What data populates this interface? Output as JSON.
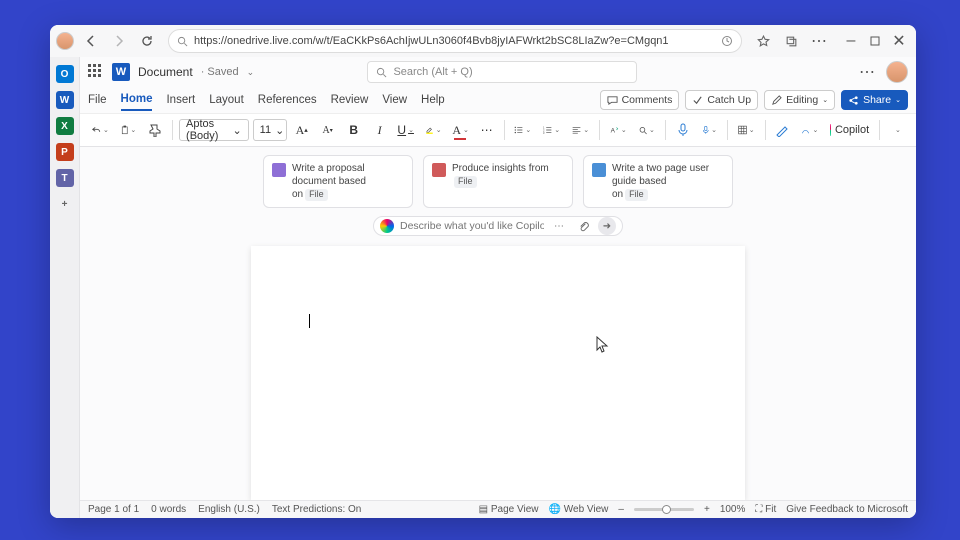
{
  "browser": {
    "url": "https://onedrive.live.com/w/t/EaCKkPs6AchIjwULn3060f4Bvb8jyIAFWrkt2bSC8LIaZw?e=CMgqn1",
    "buttons": {
      "back": "←",
      "forward": "→",
      "refresh": "↻",
      "fav": "☆",
      "collections": "⧉",
      "more": "⋯",
      "min": "–",
      "max": "▢",
      "close": "✕"
    }
  },
  "rail": [
    {
      "name": "outlook",
      "bg": "#0078d4",
      "txt": "O"
    },
    {
      "name": "word",
      "bg": "#185abd",
      "txt": "W"
    },
    {
      "name": "excel",
      "bg": "#107c41",
      "txt": "X"
    },
    {
      "name": "powerpoint",
      "bg": "#c43e1c",
      "txt": "P"
    },
    {
      "name": "teams",
      "bg": "#6264a7",
      "txt": "T"
    },
    {
      "name": "add",
      "bg": "transparent",
      "txt": "+",
      "fg": "#666"
    }
  ],
  "header": {
    "doc_name": "Document",
    "doc_state": "· Saved",
    "search_placeholder": "Search (Alt + Q)"
  },
  "tabs": [
    "File",
    "Home",
    "Insert",
    "Layout",
    "References",
    "Review",
    "View",
    "Help"
  ],
  "active_tab": "Home",
  "tab_buttons": {
    "comments": "Comments",
    "catchup": "Catch Up",
    "editing": "Editing",
    "share": "Share"
  },
  "ribbon": {
    "font_name": "Aptos (Body)",
    "font_size": "11",
    "copilot": "Copilot"
  },
  "copilot": {
    "suggestions": [
      {
        "icon": "#8e6fd6",
        "text_a": "Write a proposal document based",
        "text_b": "on",
        "tag": "File"
      },
      {
        "icon": "#d05a5a",
        "text_a": "Produce insights from",
        "text_b": "",
        "tag": "File"
      },
      {
        "icon": "#4a8fd6",
        "text_a": "Write a two page user guide based",
        "text_b": "on",
        "tag": "File"
      }
    ],
    "prompt_placeholder": "Describe what you'd like Copilot to write"
  },
  "status": {
    "page": "Page 1 of 1",
    "words": "0 words",
    "lang": "English (U.S.)",
    "predictions": "Text Predictions: On",
    "pageview": "Page View",
    "webview": "Web View",
    "zoom": "100%",
    "fit": "Fit",
    "feedback": "Give Feedback to Microsoft"
  }
}
